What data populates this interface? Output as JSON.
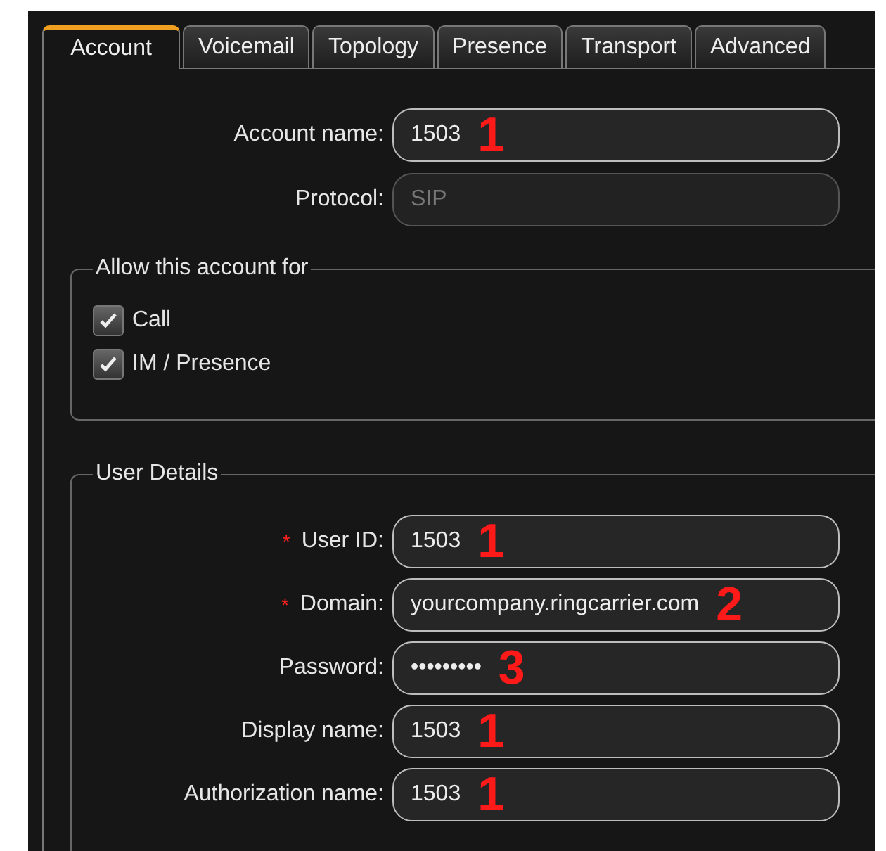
{
  "tabs": [
    {
      "label": "Account",
      "selected": true
    },
    {
      "label": "Voicemail",
      "selected": false
    },
    {
      "label": "Topology",
      "selected": false
    },
    {
      "label": "Presence",
      "selected": false
    },
    {
      "label": "Transport",
      "selected": false
    },
    {
      "label": "Advanced",
      "selected": false
    }
  ],
  "account_fields": [
    {
      "label": "Account name:",
      "value": "1503",
      "disabled": false,
      "annotation": "1"
    },
    {
      "label": "Protocol:",
      "value": "SIP",
      "disabled": true
    }
  ],
  "allow_group": {
    "title": "Allow this account for",
    "options": [
      {
        "label": "Call",
        "checked": true
      },
      {
        "label": "IM / Presence",
        "checked": true
      }
    ]
  },
  "user_details": {
    "title": "User Details",
    "fields": [
      {
        "label": "User ID:",
        "value": "1503",
        "marker": "*",
        "annotation": "1"
      },
      {
        "label": "Domain:",
        "value": "yourcompany.ringcarrier.com",
        "marker": "*",
        "annotation": "2"
      },
      {
        "label": "Password:",
        "value": "•••••••••",
        "annotation": "3"
      },
      {
        "label": "Display name:",
        "value": "1503",
        "annotation": "1"
      },
      {
        "label": "Authorization name:",
        "value": "1503",
        "annotation": "1"
      }
    ]
  }
}
